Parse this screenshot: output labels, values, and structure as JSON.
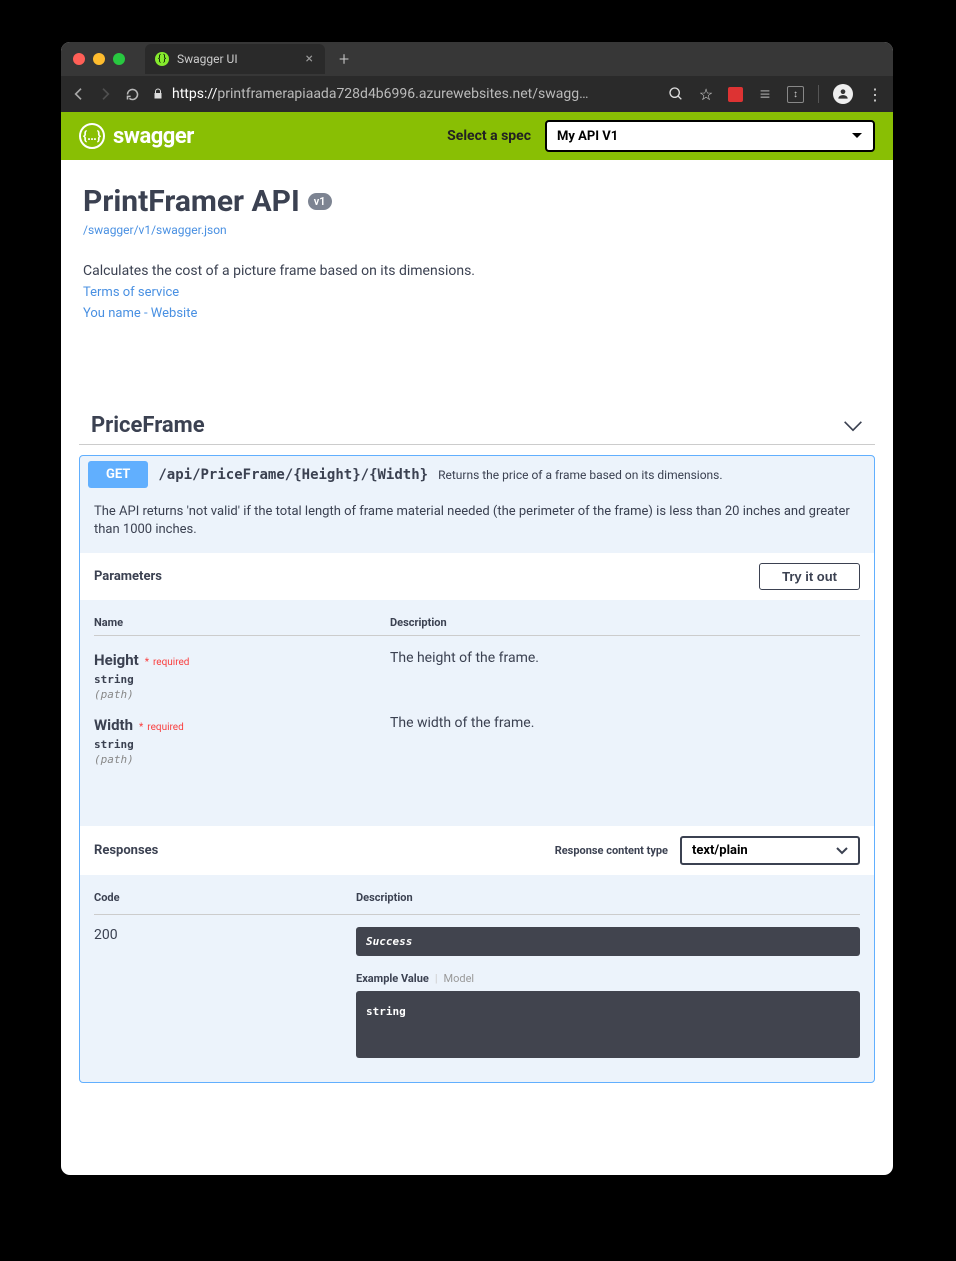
{
  "browser": {
    "tab_title": "Swagger UI",
    "url_display": "printframerapiaada728d4b6996.azurewebsites.net/swagg…",
    "url_prefix": "https://"
  },
  "topbar": {
    "brand": "swagger",
    "select_label": "Select a spec",
    "spec_selected": "My API V1"
  },
  "info": {
    "title": "PrintFramer API",
    "version": "v1",
    "swagger_url": "/swagger/v1/swagger.json",
    "description": "Calculates the cost of a picture frame based on its dimensions.",
    "terms": "Terms of service",
    "contact": "You name - Website"
  },
  "section": {
    "name": "PriceFrame"
  },
  "operation": {
    "method": "GET",
    "path": "/api/PriceFrame/{Height}/{Width}",
    "summary": "Returns the price of a frame based on its dimensions.",
    "description": "The API returns 'not valid' if the total length of frame material needed (the perimeter of the frame) is less than 20 inches and greater than 1000 inches.",
    "parameters_label": "Parameters",
    "try_it_out": "Try it out",
    "headers": {
      "name": "Name",
      "description": "Description"
    },
    "params": [
      {
        "name": "Height",
        "required": "required",
        "type": "string",
        "in": "(path)",
        "description": "The height of the frame."
      },
      {
        "name": "Width",
        "required": "required",
        "type": "string",
        "in": "(path)",
        "description": "The width of the frame."
      }
    ],
    "responses_label": "Responses",
    "content_type_label": "Response content type",
    "content_type_value": "text/plain",
    "resp_headers": {
      "code": "Code",
      "description": "Description"
    },
    "response": {
      "code": "200",
      "description": "Success",
      "example_value_label": "Example Value",
      "model_label": "Model",
      "example": "string"
    }
  }
}
